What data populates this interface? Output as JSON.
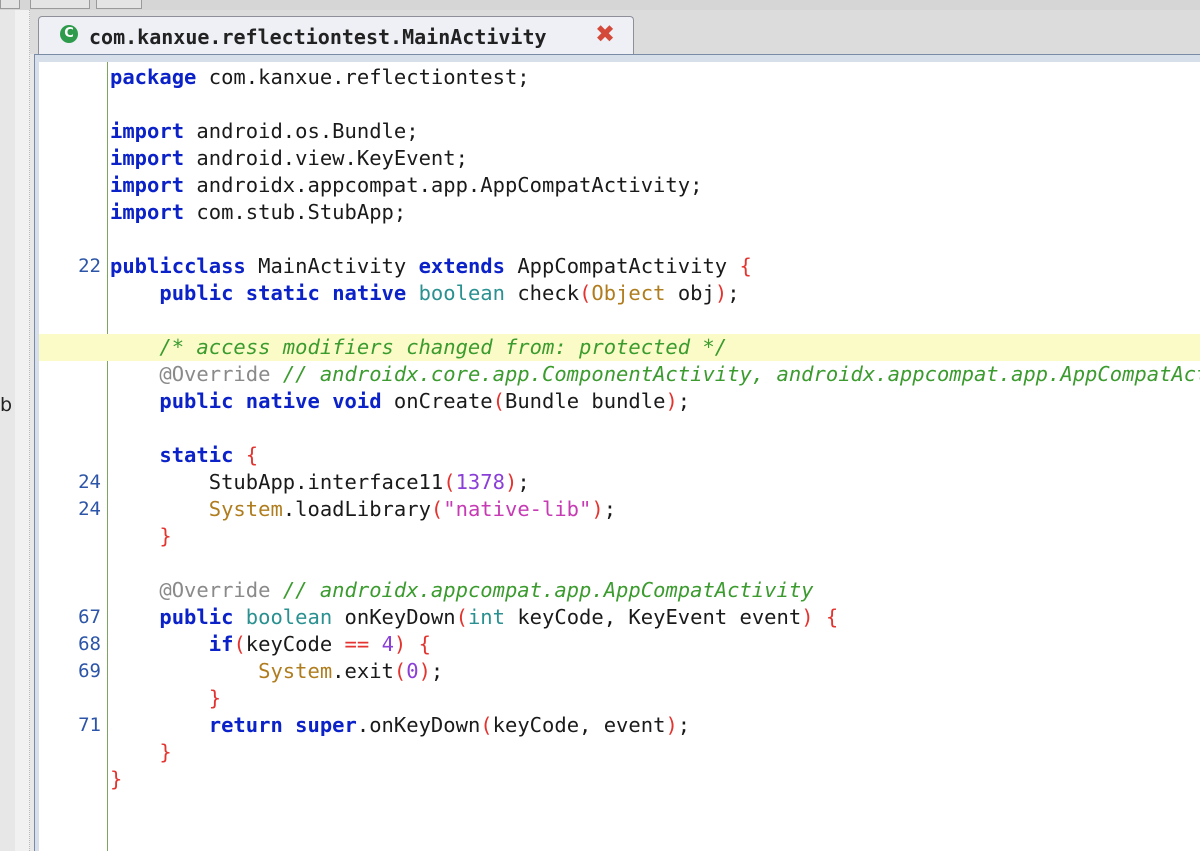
{
  "tab": {
    "title": "com.kanxue.reflectiontest.MainActivity",
    "icon": "class-icon",
    "icon_glyph": "C",
    "close_icon": "close-icon",
    "close_glyph": "✖"
  },
  "sidebar": {
    "label": "b"
  },
  "code": {
    "lines": [
      {
        "num": "",
        "tokens": [
          [
            "kw",
            "package"
          ],
          [
            "",
            "com.kanxue.reflectiontest;"
          ]
        ]
      },
      {
        "num": "",
        "tokens": []
      },
      {
        "num": "",
        "tokens": [
          [
            "kw",
            "import"
          ],
          [
            "",
            "android.os.Bundle;"
          ]
        ]
      },
      {
        "num": "",
        "tokens": [
          [
            "kw",
            "import"
          ],
          [
            "",
            "android.view.KeyEvent;"
          ]
        ]
      },
      {
        "num": "",
        "tokens": [
          [
            "kw",
            "import"
          ],
          [
            "",
            "androidx.appcompat.app.AppCompatActivity;"
          ]
        ]
      },
      {
        "num": "",
        "tokens": [
          [
            "kw",
            "import"
          ],
          [
            "",
            "com.stub.StubApp;"
          ]
        ]
      },
      {
        "num": "",
        "tokens": []
      },
      {
        "num": "22",
        "tokens": [
          [
            "kw",
            "public"
          ],
          [
            "",
            ""
          ],
          [
            "kw",
            "class"
          ],
          [
            "",
            "MainActivity"
          ],
          [
            "kw",
            "extends"
          ],
          [
            "",
            "AppCompatActivity"
          ],
          [
            "br",
            "{"
          ]
        ]
      },
      {
        "num": "",
        "tokens": [
          [
            "",
            "    "
          ],
          [
            "kw",
            "public"
          ],
          [
            "kw",
            "static"
          ],
          [
            "kw",
            "native"
          ],
          [
            "bi",
            "boolean"
          ],
          [
            "",
            "check"
          ],
          [
            "br",
            "("
          ],
          [
            "cls",
            "Object"
          ],
          [
            "",
            "obj"
          ],
          [
            "br",
            ")"
          ],
          [
            "",
            ";"
          ]
        ]
      },
      {
        "num": "",
        "tokens": []
      },
      {
        "num": "",
        "highlight": true,
        "tokens": [
          [
            "",
            "    "
          ],
          [
            "cm",
            "/* access modifiers changed from: protected */"
          ]
        ]
      },
      {
        "num": "",
        "tokens": [
          [
            "",
            "    "
          ],
          [
            "ann",
            "@Override"
          ],
          [
            "cm",
            "// androidx.core.app.ComponentActivity, androidx.appcompat.app.AppCompatActivity"
          ]
        ]
      },
      {
        "num": "",
        "tokens": [
          [
            "",
            "    "
          ],
          [
            "kw",
            "public"
          ],
          [
            "kw",
            "native"
          ],
          [
            "kw",
            "void"
          ],
          [
            "",
            "onCreate"
          ],
          [
            "br",
            "("
          ],
          [
            "",
            "Bundle bundle"
          ],
          [
            "br",
            ")"
          ],
          [
            "",
            ";"
          ]
        ]
      },
      {
        "num": "",
        "tokens": []
      },
      {
        "num": "",
        "tokens": [
          [
            "",
            "    "
          ],
          [
            "kw",
            "static"
          ],
          [
            "br",
            "{"
          ]
        ]
      },
      {
        "num": "24",
        "tokens": [
          [
            "",
            "        StubApp.interface11"
          ],
          [
            "br",
            "("
          ],
          [
            "num",
            "1378"
          ],
          [
            "br",
            ")"
          ],
          [
            "",
            ";"
          ]
        ]
      },
      {
        "num": "24",
        "tokens": [
          [
            "",
            "        "
          ],
          [
            "cls",
            "System"
          ],
          [
            "",
            ".loadLibrary"
          ],
          [
            "br",
            "("
          ],
          [
            "str",
            "\"native-lib\""
          ],
          [
            "br",
            ")"
          ],
          [
            "",
            ";"
          ]
        ]
      },
      {
        "num": "",
        "tokens": [
          [
            "",
            "    "
          ],
          [
            "br",
            "}"
          ]
        ]
      },
      {
        "num": "",
        "tokens": []
      },
      {
        "num": "",
        "tokens": [
          [
            "",
            "    "
          ],
          [
            "ann",
            "@Override"
          ],
          [
            "cm",
            "// androidx.appcompat.app.AppCompatActivity"
          ]
        ]
      },
      {
        "num": "67",
        "tokens": [
          [
            "",
            "    "
          ],
          [
            "kw",
            "public"
          ],
          [
            "bi",
            "boolean"
          ],
          [
            "",
            "onKeyDown"
          ],
          [
            "br",
            "("
          ],
          [
            "bi",
            "int"
          ],
          [
            "",
            "keyCode, KeyEvent event"
          ],
          [
            "br",
            ")"
          ],
          [
            "br",
            "{"
          ]
        ]
      },
      {
        "num": "68",
        "tokens": [
          [
            "",
            "        "
          ],
          [
            "kw",
            "if"
          ],
          [
            "br",
            "("
          ],
          [
            "",
            "keyCode"
          ],
          [
            "op",
            "=="
          ],
          [
            "num",
            "4"
          ],
          [
            "br",
            ")"
          ],
          [
            "br",
            "{"
          ]
        ]
      },
      {
        "num": "69",
        "tokens": [
          [
            "",
            "            "
          ],
          [
            "cls",
            "System"
          ],
          [
            "",
            ".exit"
          ],
          [
            "br",
            "("
          ],
          [
            "num",
            "0"
          ],
          [
            "br",
            ")"
          ],
          [
            "",
            ";"
          ]
        ]
      },
      {
        "num": "",
        "tokens": [
          [
            "",
            "        "
          ],
          [
            "br",
            "}"
          ]
        ]
      },
      {
        "num": "71",
        "tokens": [
          [
            "",
            "        "
          ],
          [
            "kw",
            "return"
          ],
          [
            "kw",
            "super"
          ],
          [
            "",
            ".onKeyDown"
          ],
          [
            "br",
            "("
          ],
          [
            "",
            "keyCode, event"
          ],
          [
            "br",
            ")"
          ],
          [
            "",
            ";"
          ]
        ]
      },
      {
        "num": "",
        "tokens": [
          [
            "",
            "    "
          ],
          [
            "br",
            "}"
          ]
        ]
      },
      {
        "num": "",
        "tokens": [
          [
            "br",
            "}"
          ]
        ]
      }
    ]
  },
  "colors": {
    "keyword": "#0b22c8",
    "builtin_type": "#2a9090",
    "class_ref": "#b07d1e",
    "bracket": "#e3342f",
    "number": "#8a3fd6",
    "string": "#c63ab3",
    "comment": "#3b9b2e",
    "annotation": "#8a8a8a",
    "line_number": "#2c55a8",
    "highlight_line": "#fbfbc8"
  }
}
